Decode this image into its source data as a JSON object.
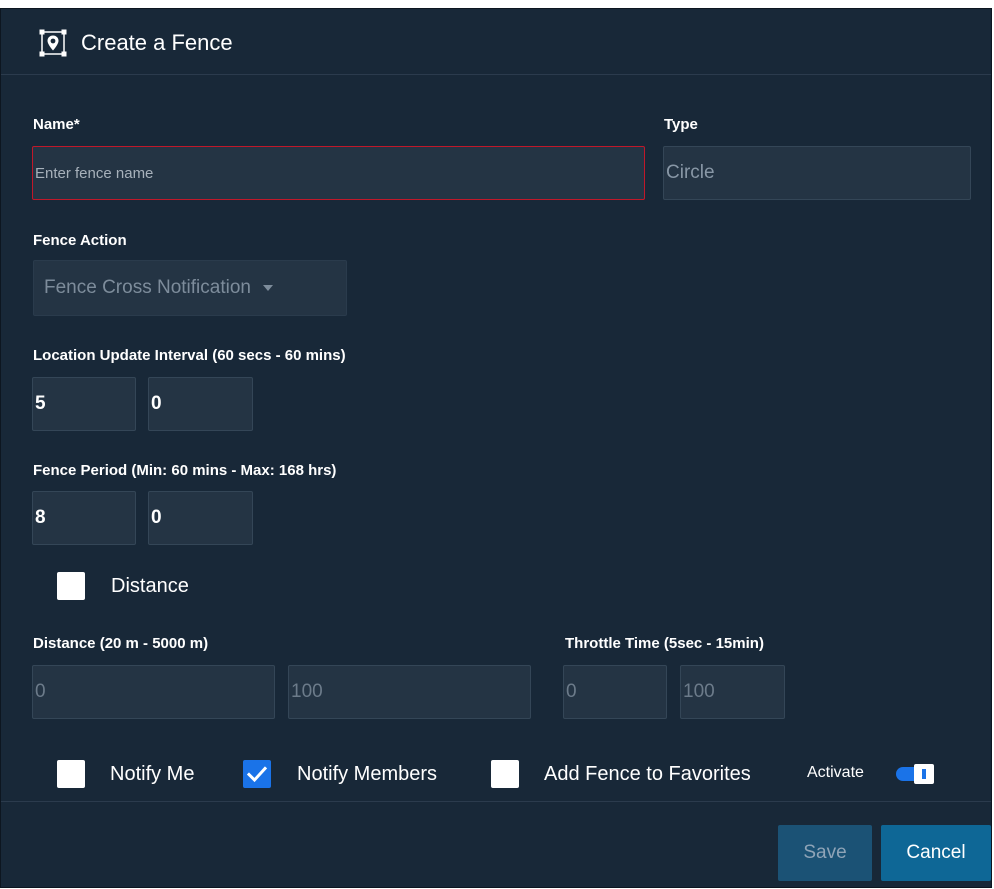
{
  "dialog": {
    "title": "Create a Fence",
    "title_icon": "map-pin-frame-icon"
  },
  "form": {
    "name": {
      "label": "Name*",
      "value": "",
      "placeholder": "Enter fence name"
    },
    "type": {
      "label": "Type",
      "value": "Circle"
    },
    "fence_action": {
      "label": "Fence Action",
      "selected": "Fence Cross Notification"
    },
    "location_update_interval": {
      "label": "Location Update Interval (60 secs - 60 mins)",
      "first_value": "5",
      "second_value": "0"
    },
    "fence_period": {
      "label": "Fence Period (Min: 60 mins - Max: 168 hrs)",
      "first_value": "8",
      "second_value": "0"
    },
    "distance_toggle": {
      "label": "Distance",
      "checked": false
    },
    "distance": {
      "label": "Distance (20 m - 5000 m)",
      "min_value": "0",
      "max_value": "100"
    },
    "throttle_time": {
      "label": "Throttle Time (5sec - 15min)",
      "min_value": "0",
      "max_value": "100"
    },
    "options": {
      "notify_me": {
        "label": "Notify Me",
        "checked": false
      },
      "notify_members": {
        "label": "Notify Members",
        "checked": true
      },
      "add_to_favorites": {
        "label": "Add Fence to Favorites",
        "checked": false
      },
      "activate": {
        "label": "Activate",
        "on": true
      }
    }
  },
  "footer": {
    "save_label": "Save",
    "cancel_label": "Cancel"
  },
  "colors": {
    "dialog_background": "#182838",
    "input_background": "#243444",
    "error_border": "#c0182a",
    "checkbox_checked": "#1a73e8",
    "cancel_button": "#0e6796",
    "save_button": "#1b5275"
  }
}
